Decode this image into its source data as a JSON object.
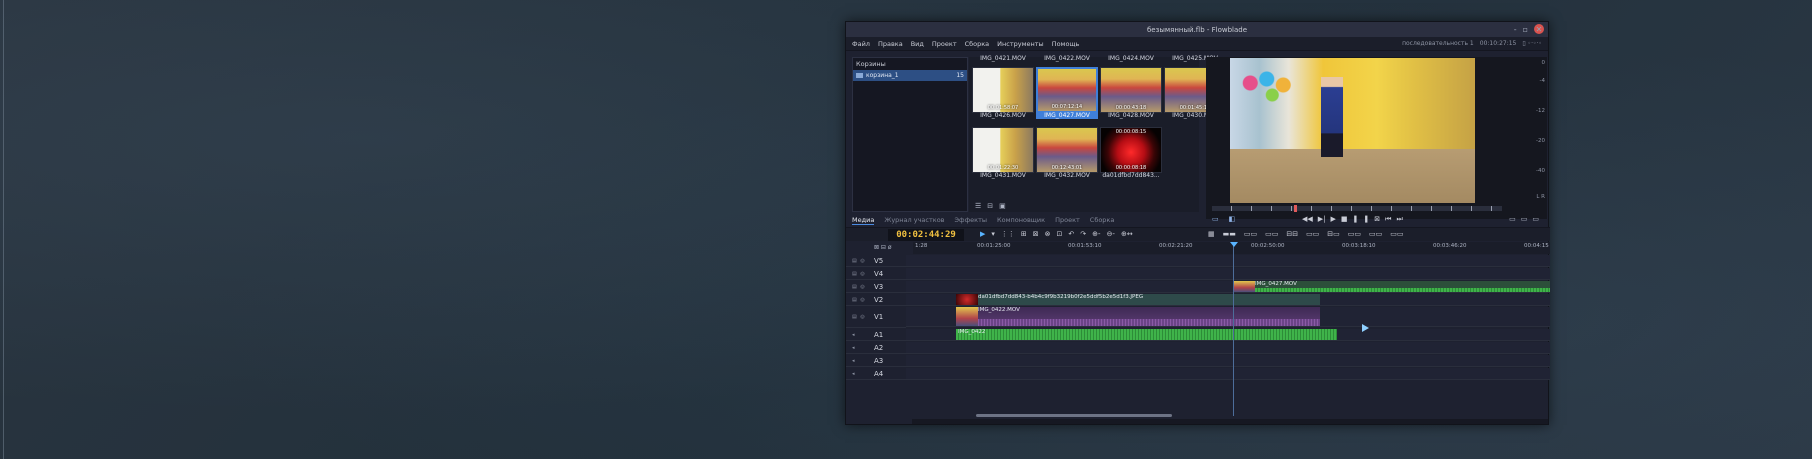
{
  "window": {
    "title": "безымянный.flb - Flowblade",
    "controls": {
      "minimize": "-",
      "maximize": "▫",
      "close": "✕"
    }
  },
  "menubar": {
    "items": [
      "Файл",
      "Правка",
      "Вид",
      "Проект",
      "Сборка",
      "Инструменты",
      "Помощь"
    ],
    "sequence": "последовательность 1",
    "duration": "00:10:27:15",
    "right_icons": "▯ ◦·◦·◦"
  },
  "bins": {
    "title": "Корзины",
    "items": [
      {
        "name": "корзина_1",
        "count": "15"
      }
    ]
  },
  "clips": [
    {
      "name": "IMG_0421.MOV",
      "time": "",
      "style": "stage",
      "label_pos": "top"
    },
    {
      "name": "IMG_0422.MOV",
      "time": "",
      "style": "stage",
      "label_pos": "top"
    },
    {
      "name": "IMG_0424.MOV",
      "time": "",
      "style": "stage",
      "label_pos": "top"
    },
    {
      "name": "IMG_0425.MOV",
      "time": "",
      "style": "stage",
      "label_pos": "top"
    },
    {
      "name": "IMG_0426.MOV",
      "time": "00:01:58:07",
      "style": "white",
      "label_pos": "bot"
    },
    {
      "name": "IMG_0427.MOV",
      "time": "00:07:12:14",
      "style": "stage",
      "label_pos": "bot",
      "selected": true
    },
    {
      "name": "IMG_0428.MOV",
      "time": "00:00:43:18",
      "style": "stage",
      "label_pos": "bot"
    },
    {
      "name": "IMG_0430.MOV",
      "time": "00:01:45:11",
      "style": "stage",
      "label_pos": "bot"
    },
    {
      "name": "IMG_0431.MOV",
      "time": "00:01:22:30",
      "style": "white",
      "label_pos": "bot"
    },
    {
      "name": "IMG_0432.MOV",
      "time": "00:12:43:01",
      "style": "stage",
      "label_pos": "bot"
    },
    {
      "name": "da01dfbd7dd843...",
      "time": "00:00:08:18",
      "style": "red",
      "label_pos": "bot",
      "top_time": "00:00:08:15"
    }
  ],
  "clip_tools": [
    "☰",
    "⊟",
    "▣"
  ],
  "monitor": {
    "db_scale": [
      "0",
      "-4",
      "-12",
      "-20",
      "-40",
      "L R"
    ],
    "transport": [
      "◀◀",
      "▶|",
      "▶",
      "■",
      "❚",
      "❚",
      "⊠",
      "⏮",
      "⏭"
    ],
    "extra_icons": [
      "▭",
      "◧"
    ],
    "right_icons": [
      "▭",
      "▭",
      "▭"
    ]
  },
  "tabs": {
    "items": [
      "Медиа",
      "Журнал участков",
      "Эффекты",
      "Компоновщик",
      "Проект",
      "Сборка"
    ],
    "active": "Медиа"
  },
  "timeline": {
    "timecode": "00:02:44:29",
    "tools_left": [
      "▶",
      "▾",
      "⋮⋮",
      "⊞",
      "⊠",
      "⊗",
      "⊡",
      "↶",
      "↷",
      "⊕-",
      "⊖-",
      "⊕↔"
    ],
    "tools_right": [
      "▦",
      "▬▬",
      "▭▭",
      "▭▭",
      "⊟⊟",
      "▭▭",
      "⊟▭",
      "▭▭",
      "▭▭",
      "▭▭"
    ],
    "ruler_ticks": [
      "1:28",
      "00:01:25:00",
      "00:01:53:10",
      "00:02:21:20",
      "00:02:50:00",
      "00:03:18:10",
      "00:03:46:20",
      "00:04:15"
    ],
    "ruler_icons": "⊠ ⊟ ø",
    "tracks": [
      {
        "name": "V5",
        "icons": "▤ ◎"
      },
      {
        "name": "V4",
        "icons": "▤ ◎"
      },
      {
        "name": "V3",
        "icons": "▤ ◎"
      },
      {
        "name": "V2",
        "icons": "▤ ◎"
      },
      {
        "name": "V1",
        "icons": "▤ ◎"
      },
      {
        "name": "A1",
        "icons": "◂"
      },
      {
        "name": "A2",
        "icons": "◂"
      },
      {
        "name": "A3",
        "icons": "◂"
      },
      {
        "name": "A4",
        "icons": "◂"
      }
    ],
    "clip_labels": {
      "v3": "IMG_0427.MOV",
      "v2": "da01dfbd7dd843-b4b4c9f9b3219b0f2e5ddf5b2e5d1f3.JPEG",
      "v1": "IMG_0422.MOV",
      "a1": "IMG_0422"
    }
  },
  "colors": {
    "timecode": "#f0c040",
    "accent": "#3f7fd9",
    "audio_wave": "#3fb34a",
    "v1_clip": "#5b3b72"
  }
}
